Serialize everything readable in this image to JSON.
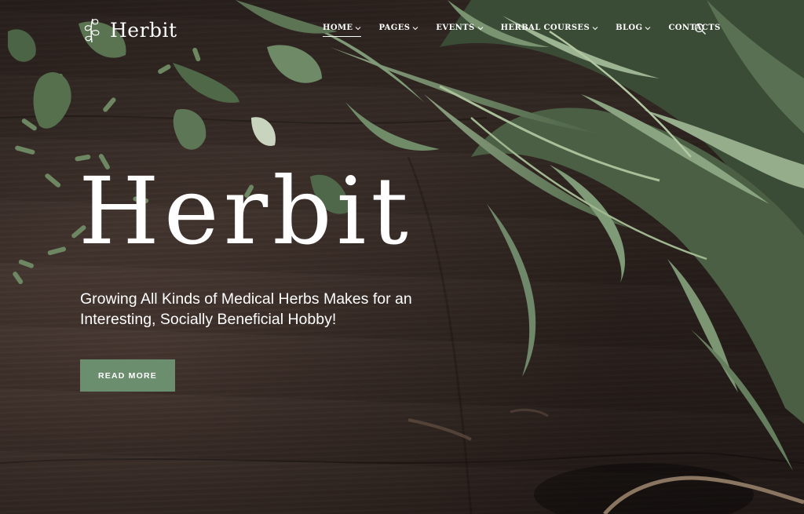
{
  "brand": {
    "name": "Herbit",
    "logo_icon": "leaf-sprig-icon"
  },
  "nav": {
    "items": [
      {
        "label": "HOME",
        "has_dropdown": true,
        "active": true
      },
      {
        "label": "PAGES",
        "has_dropdown": true,
        "active": false
      },
      {
        "label": "EVENTS",
        "has_dropdown": true,
        "active": false
      },
      {
        "label": "HERBAL COURSES",
        "has_dropdown": true,
        "active": false
      },
      {
        "label": "BLOG",
        "has_dropdown": true,
        "active": false
      },
      {
        "label": "CONTACTS",
        "has_dropdown": false,
        "active": false
      }
    ],
    "search_icon": "search-icon"
  },
  "hero": {
    "title": "Herbit",
    "subtitle": "Growing All Kinds of Medical Herbs Makes for an Interesting, Socially Beneficial Hobby!",
    "cta_label": "READ MORE"
  },
  "colors": {
    "accent": "#6b8f6e",
    "text": "#ffffff",
    "background": "#3e302a",
    "leaf": "#5f7a55"
  }
}
